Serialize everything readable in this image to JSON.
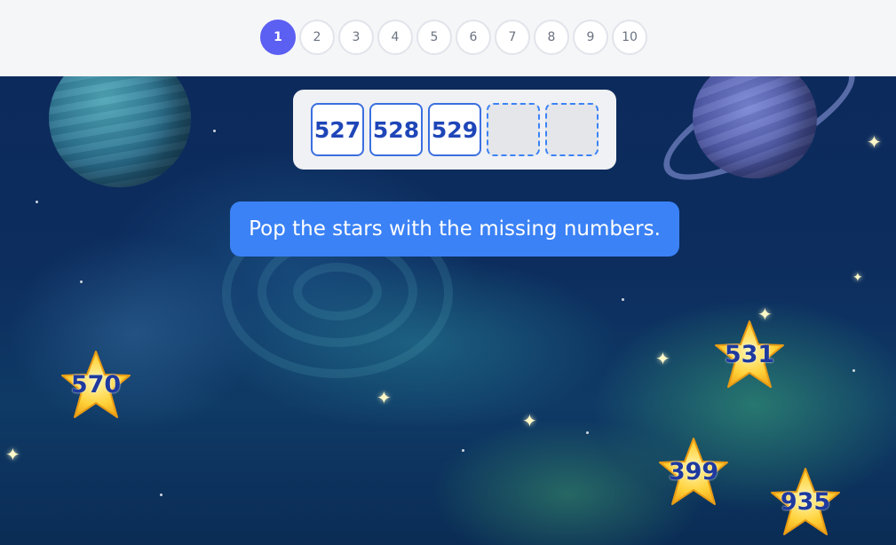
{
  "progress": {
    "steps": [
      "1",
      "2",
      "3",
      "4",
      "5",
      "6",
      "7",
      "8",
      "9",
      "10"
    ],
    "current": "1",
    "accent_color": "#5b5ff2"
  },
  "sequence": {
    "tiles": [
      {
        "value": "527",
        "filled": true
      },
      {
        "value": "528",
        "filled": true
      },
      {
        "value": "529",
        "filled": true
      },
      {
        "value": "",
        "filled": false
      },
      {
        "value": "",
        "filled": false
      }
    ]
  },
  "instruction": {
    "text": "Pop the stars with the missing numbers.",
    "color": "#3b82f6"
  },
  "stars": [
    {
      "value": "570",
      "icon": "star-icon"
    },
    {
      "value": "531",
      "icon": "star-icon"
    },
    {
      "value": "399",
      "icon": "star-icon"
    },
    {
      "value": "935",
      "icon": "star-icon"
    }
  ]
}
